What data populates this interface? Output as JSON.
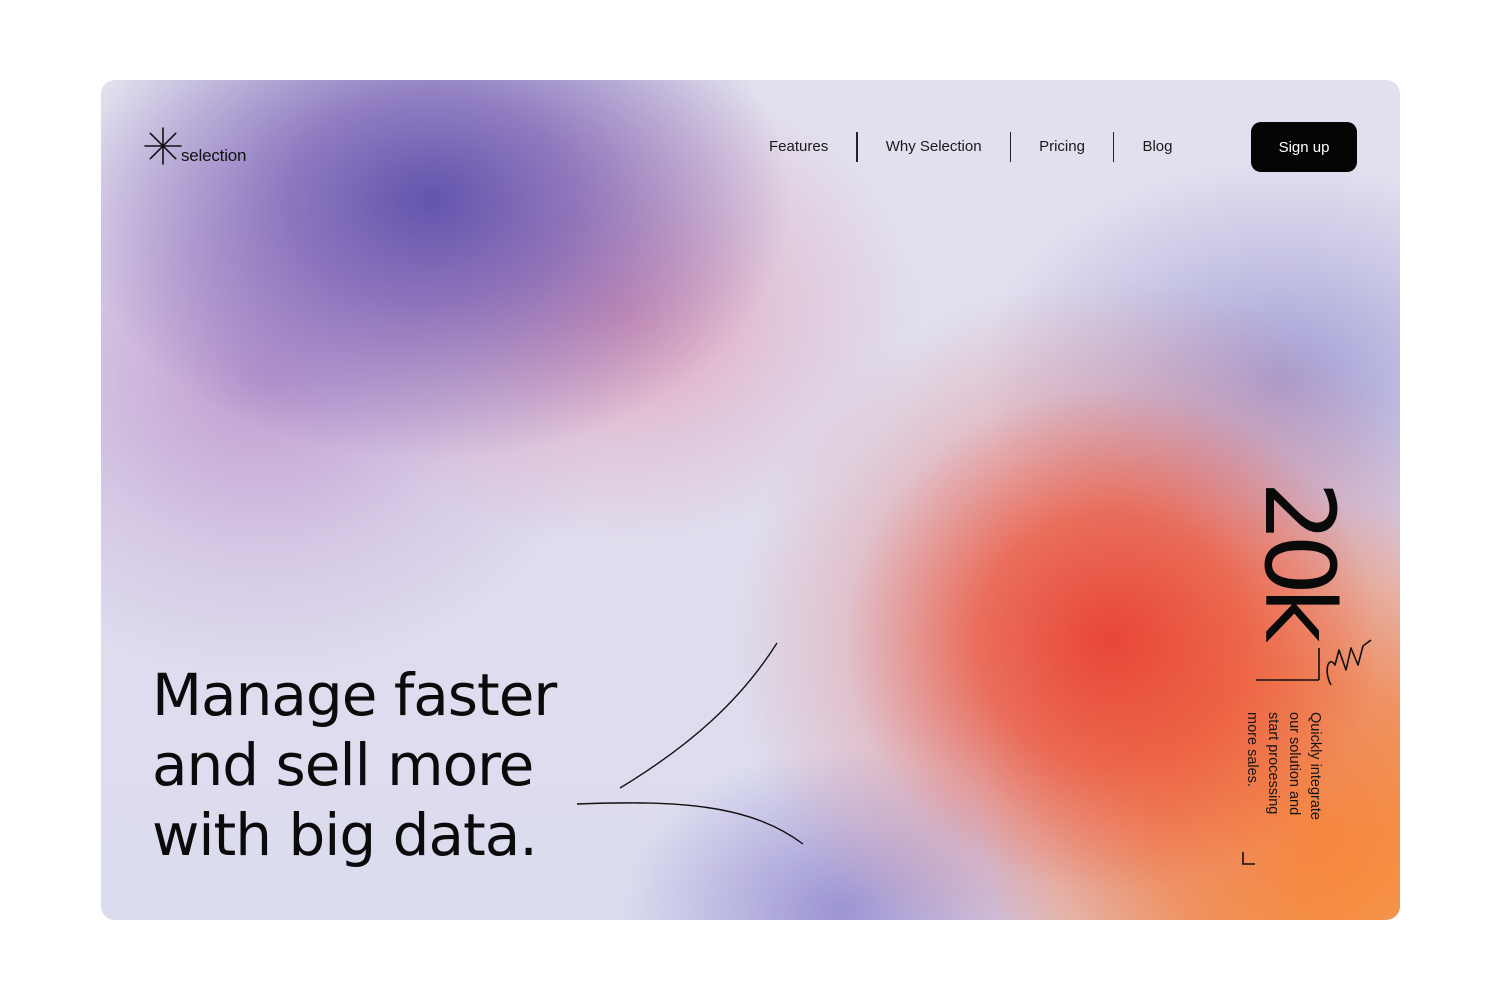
{
  "brand": {
    "name": "selection",
    "logo_icon": "asterisk-icon"
  },
  "nav": {
    "items": [
      {
        "label": "Features"
      },
      {
        "label": "Why Selection"
      },
      {
        "label": "Pricing"
      },
      {
        "label": "Blog"
      }
    ],
    "signup_label": "Sign up"
  },
  "hero": {
    "headline_lines": [
      "Manage faster",
      "and sell more",
      "with big data."
    ]
  },
  "stat": {
    "value": "20k",
    "description_lines": [
      "Quickly integrate",
      "our solution and",
      "start processing",
      "more sales."
    ]
  },
  "colors": {
    "button_bg": "#050505",
    "text": "#0b0b0b",
    "accent_orange": "#fc821e",
    "accent_red": "#e84637",
    "accent_purple": "#5c4eaa"
  }
}
